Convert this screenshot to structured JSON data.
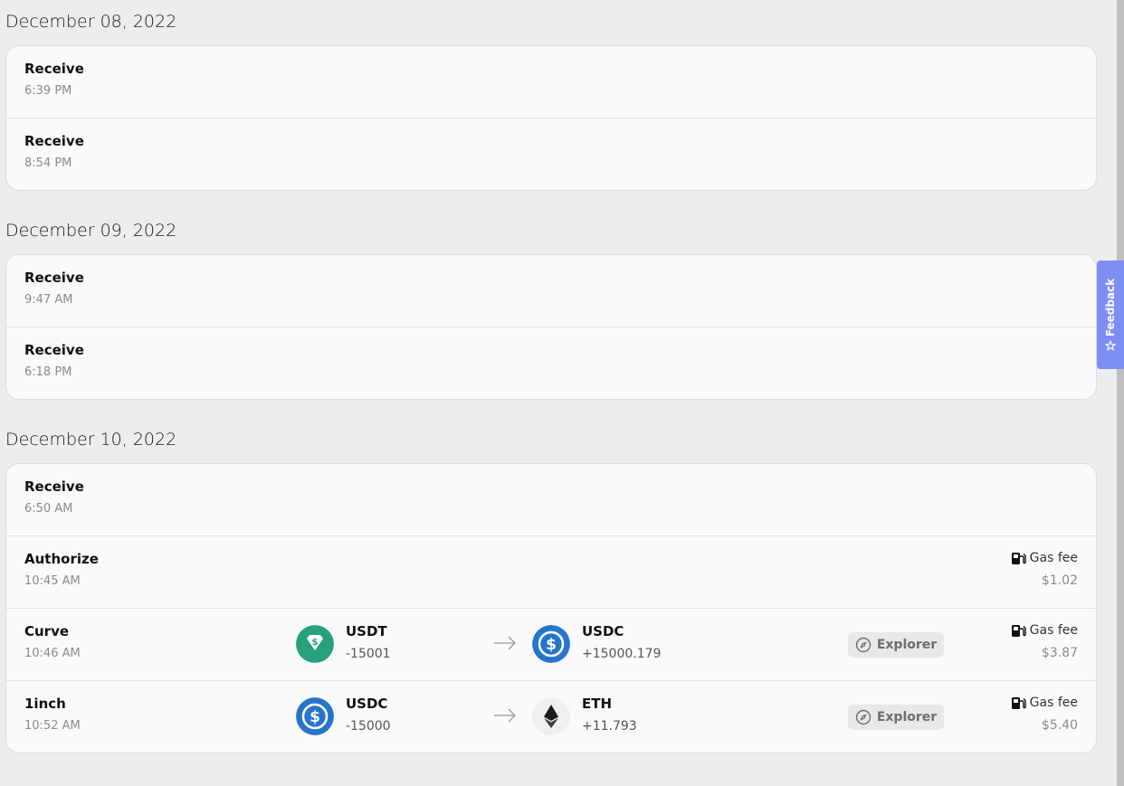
{
  "groups": [
    {
      "date": "December 08, 2022",
      "rows": [
        {
          "title": "Receive",
          "time": "6:39 PM"
        },
        {
          "title": "Receive",
          "time": "8:54 PM"
        }
      ]
    },
    {
      "date": "December 09, 2022",
      "rows": [
        {
          "title": "Receive",
          "time": "9:47 AM"
        },
        {
          "title": "Receive",
          "time": "6:18 PM"
        }
      ]
    },
    {
      "date": "December 10, 2022",
      "rows": [
        {
          "title": "Receive",
          "time": "6:50 AM"
        },
        {
          "title": "Authorize",
          "time": "10:45 AM",
          "gas_label": "Gas fee",
          "gas_value": "$1.02"
        },
        {
          "title": "Curve",
          "time": "10:46 AM",
          "from": {
            "symbol": "USDT",
            "amount": "-15001",
            "icon": "usdt-icon"
          },
          "to": {
            "symbol": "USDC",
            "amount": "+15000.179",
            "icon": "usdc-icon"
          },
          "explorer_label": "Explorer",
          "gas_label": "Gas fee",
          "gas_value": "$3.87"
        },
        {
          "title": "1inch",
          "time": "10:52 AM",
          "from": {
            "symbol": "USDC",
            "amount": "-15000",
            "icon": "usdc-icon"
          },
          "to": {
            "symbol": "ETH",
            "amount": "+11.793",
            "icon": "eth-icon"
          },
          "explorer_label": "Explorer",
          "gas_label": "Gas fee",
          "gas_value": "$5.40"
        }
      ]
    }
  ],
  "feedback": {
    "label": "Feedback",
    "icon": "star-sparkle-icon"
  },
  "colors": {
    "usdt": "#26a17b",
    "usdc": "#2775ca",
    "eth": "#1c1c1c",
    "feedback": "#7d8ff0",
    "background": "#ededee"
  }
}
